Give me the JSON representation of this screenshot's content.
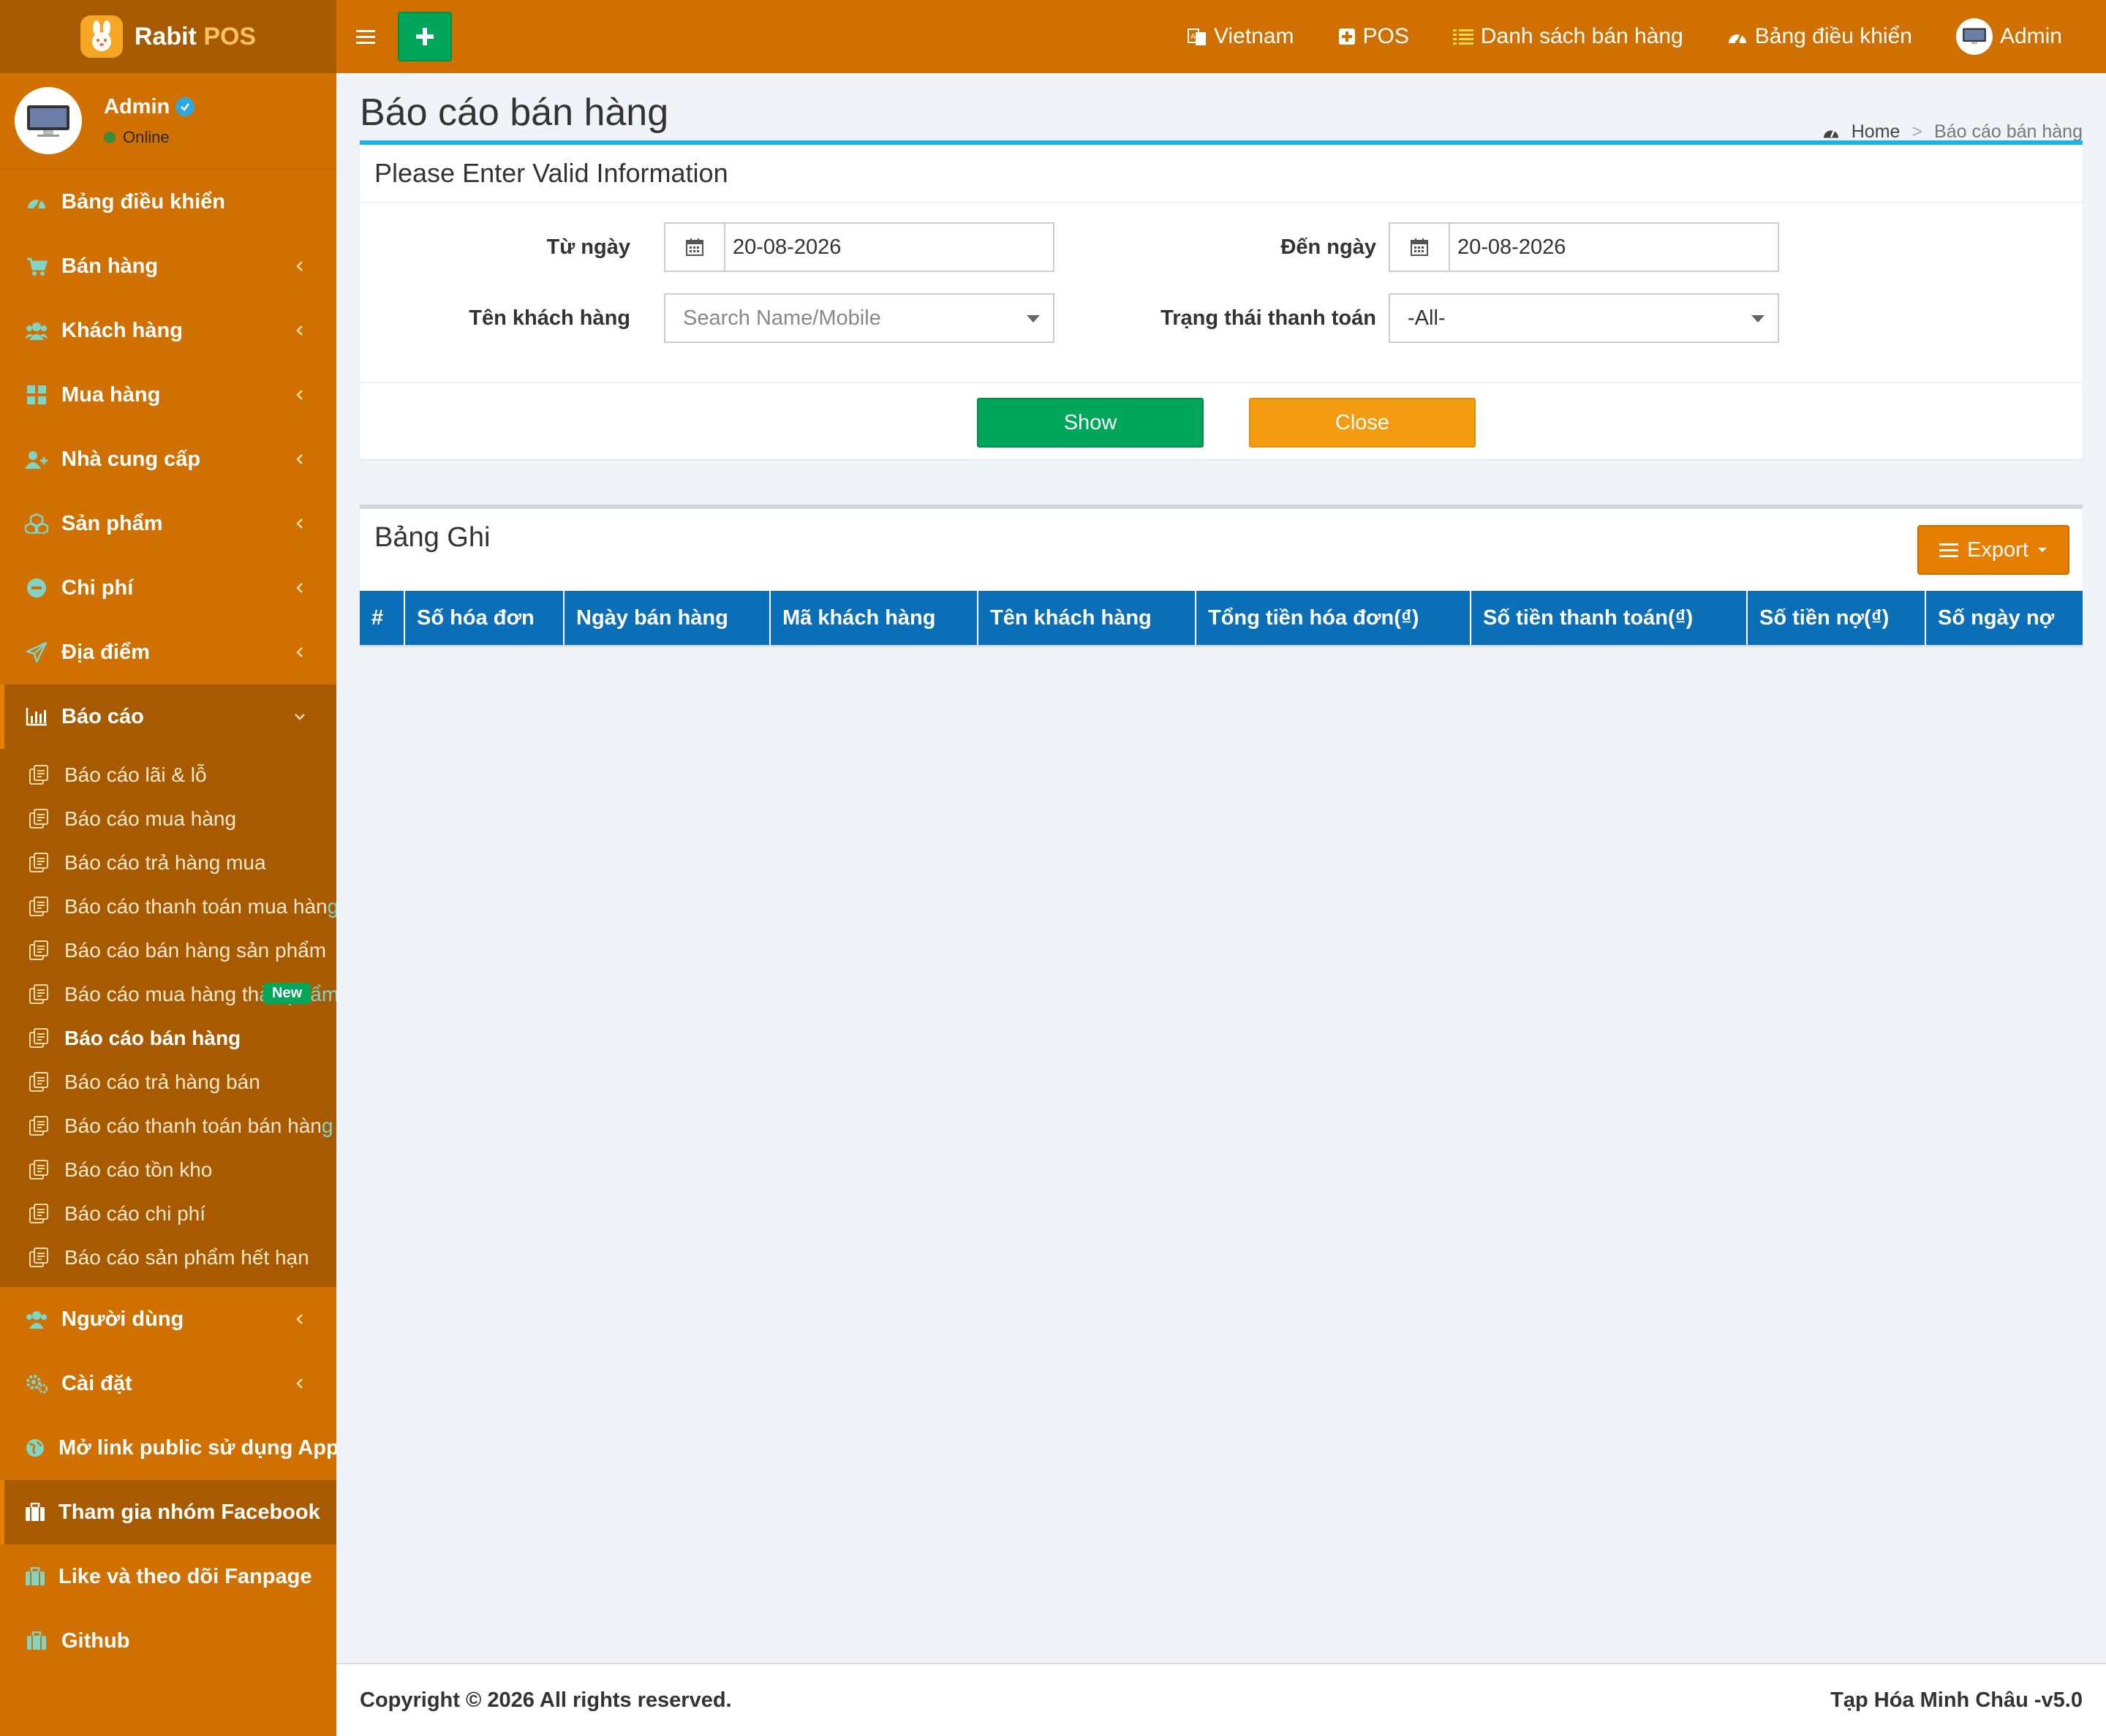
{
  "brand": {
    "name": "Rabit",
    "suffix": "POS"
  },
  "user": {
    "name": "Admin",
    "status": "Online"
  },
  "sidebar": {
    "items_top": [
      {
        "label": "Bảng điều khiển",
        "icon": "dashboard-icon"
      },
      {
        "label": "Bán hàng",
        "icon": "cart-icon"
      },
      {
        "label": "Khách hàng",
        "icon": "users-icon"
      },
      {
        "label": "Mua hàng",
        "icon": "grid-icon"
      },
      {
        "label": "Nhà cung cấp",
        "icon": "user-plus-icon"
      },
      {
        "label": "Sản phẩm",
        "icon": "cubes-icon"
      },
      {
        "label": "Chi phí",
        "icon": "minus-circle-icon"
      },
      {
        "label": "Địa điểm",
        "icon": "paper-plane-icon"
      },
      {
        "label": "Báo cáo",
        "icon": "bar-chart-icon"
      }
    ],
    "report_sub": [
      {
        "label": "Báo cáo lãi & lỗ",
        "overflow": ""
      },
      {
        "label": "Báo cáo mua hàng",
        "overflow": ""
      },
      {
        "label": "Báo cáo trả hàng mua",
        "overflow": ""
      },
      {
        "label": "Báo cáo thanh toán mua hàn",
        "overflow": "g"
      },
      {
        "label": "Báo cáo bán hàng sản phẩm",
        "overflow": ""
      },
      {
        "label": "Báo cáo mua hàng th",
        "overflow": "ản phẩm"
      },
      {
        "label": "Báo cáo bán hàng",
        "overflow": ""
      },
      {
        "label": "Báo cáo trả hàng bán",
        "overflow": ""
      },
      {
        "label": "Báo cáo thanh toán bán hàn",
        "overflow": "g"
      },
      {
        "label": "Báo cáo tồn kho",
        "overflow": ""
      },
      {
        "label": "Báo cáo chi phí",
        "overflow": ""
      },
      {
        "label": "Báo cáo sản phẩm hết hạn",
        "overflow": ""
      }
    ],
    "new_badge": "New",
    "items_bottom": [
      {
        "label": "Người dùng",
        "icon": "users-icon"
      },
      {
        "label": "Cài đặt",
        "icon": "cogs-icon"
      },
      {
        "label": "Mở link public sử dụng App",
        "icon": "globe-icon"
      },
      {
        "label": "Tham gia nhóm Facebook",
        "icon": "briefcase-icon"
      },
      {
        "label": "Like và theo dõi Fanpage",
        "icon": "briefcase-icon"
      },
      {
        "label": "Github",
        "icon": "briefcase-icon"
      }
    ]
  },
  "topnav": {
    "language": "Vietnam",
    "pos": "POS",
    "sales_list": "Danh sách bán hàng",
    "dashboard": "Bảng điều khiển",
    "admin": "Admin"
  },
  "page": {
    "title": "Báo cáo bán hàng",
    "breadcrumb_home": "Home",
    "breadcrumb_sep": ">",
    "breadcrumb_current": "Báo cáo bán hàng"
  },
  "filter": {
    "title": "Please Enter Valid Information",
    "from_label": "Từ ngày",
    "from_value": "20-08-2026",
    "to_label": "Đến ngày",
    "to_value": "20-08-2026",
    "customer_label": "Tên khách hàng",
    "customer_placeholder": "Search Name/Mobile",
    "payment_label": "Trạng thái thanh toán",
    "payment_value": "-All-",
    "show_label": "Show",
    "close_label": "Close"
  },
  "records": {
    "title": "Bảng Ghi",
    "export_label": "Export",
    "columns": [
      "#",
      "Số hóa đơn",
      "Ngày bán hàng",
      "Mã khách hàng",
      "Tên khách hàng",
      "Tổng tiền hóa đơn(₫)",
      "Số tiền thanh toán(₫)",
      "Số tiền nợ(₫)",
      "Số ngày nợ"
    ]
  },
  "footer": {
    "copyright": "Copyright © 2026 All rights reserved.",
    "version": "Tạp Hóa Minh Châu -v5.0"
  },
  "colors": {
    "primary": "#d07000",
    "sidebar_dark": "#a85a00",
    "show_button": "#00a65a",
    "close_button": "#f39c12",
    "table_header": "#0b6fb8",
    "box_accent": "#1ab3e8"
  }
}
